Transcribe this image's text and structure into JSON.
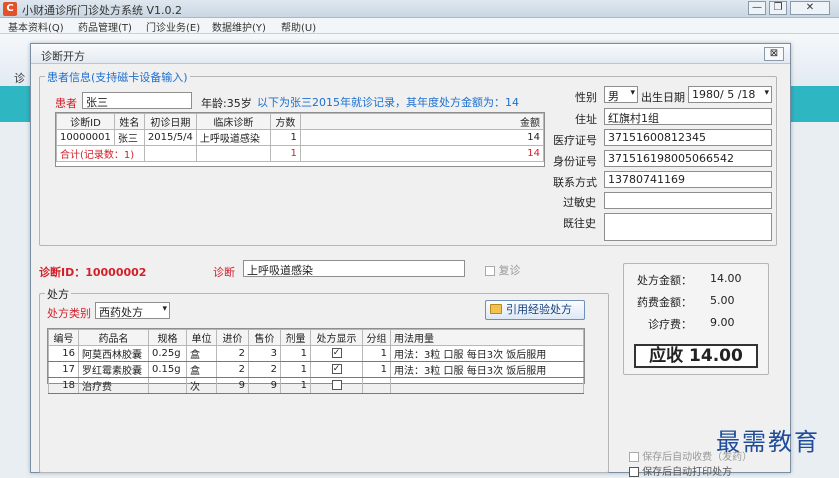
{
  "app": {
    "logo": "C",
    "title": "小财通诊所门诊处方系统 V1.0.2",
    "background_tab": "诊"
  },
  "menu": [
    "基本资料(Q)",
    "药品管理(T)",
    "门诊业务(E)",
    "数据维护(Y)",
    "帮助(U)"
  ],
  "dialog": {
    "title": "诊断开方",
    "close_label": "⊠",
    "patient_legend": "患者信息(支持磁卡设备输入)",
    "name_label": "患者",
    "name_value": "张三",
    "age_text": "年龄:35岁",
    "history_note": "以下为张三2015年就诊记录，其年度处方金额为：14",
    "history": {
      "headers": [
        "诊断ID",
        "姓名",
        "初诊日期",
        "临床诊断",
        "方数",
        "金额"
      ],
      "rows": [
        [
          "10000001",
          "张三",
          "2015/5/4",
          "上呼吸道感染",
          "1",
          "14"
        ]
      ],
      "total": {
        "label": "合计(记录数：1)",
        "fang": "1",
        "amount": "14"
      }
    },
    "gender_label": "性别",
    "gender_value": "男",
    "dob_label": "出生日期",
    "dob_value": "1980/ 5 /18",
    "address_label": "住址",
    "address_value": "红旗村1组",
    "medical_card_label": "医疗证号",
    "medical_card_value": "37151600812345",
    "id_card_label": "身份证号",
    "id_card_value": "371516198005066542",
    "contact_label": "联系方式",
    "contact_value": "13780741169",
    "allergy_label": "过敏史",
    "allergy_value": "",
    "past_history_label": "既往史",
    "past_history_value": "",
    "diagnosis_id_label": "诊断ID：10000002",
    "diagnosis_label": "诊断",
    "diagnosis_value": "上呼吸道感染",
    "revisit_label": "复诊",
    "prescription_legend": "处方",
    "rx_type_label": "处方类别",
    "rx_type_value": "西药处方",
    "cite_button": "引用经验处方",
    "rx": {
      "headers": [
        "编号",
        "药品名",
        "规格",
        "单位",
        "进价",
        "售价",
        "剂量",
        "处方显示",
        "分组",
        "用法用量"
      ],
      "rows": [
        {
          "no": "16",
          "name": "阿莫西林胶囊",
          "spec": "0.25g",
          "unit": "盒",
          "cost": "2",
          "price": "3",
          "dose": "1",
          "show": true,
          "group": "1",
          "usage": "用法：3粒 口服 每日3次 饭后服用"
        },
        {
          "no": "17",
          "name": "罗红霉素胶囊",
          "spec": "0.15g",
          "unit": "盒",
          "cost": "2",
          "price": "2",
          "dose": "1",
          "show": true,
          "group": "1",
          "usage": "用法：3粒 口服 每日3次 饭后服用"
        },
        {
          "no": "18",
          "name": "治疗费",
          "spec": "",
          "unit": "次",
          "cost": "9",
          "price": "9",
          "dose": "1",
          "show": false,
          "group": "",
          "usage": ""
        }
      ]
    },
    "summary": {
      "rx_amount_label": "处方金额：",
      "rx_amount": "14.00",
      "drug_amount_label": "药费金额：",
      "drug_amount": "5.00",
      "fee_label": "诊疗费：",
      "fee": "9.00",
      "receivable": "应收 14.00"
    },
    "auto_charge_label": "保存后自动收费（发药）",
    "auto_print_label": "保存后自动打印处方"
  },
  "watermark": "最需教育",
  "colors": {
    "accent_red": "#d2202a",
    "accent_blue": "#1c6fd0",
    "teal": "#2eb6c2"
  }
}
